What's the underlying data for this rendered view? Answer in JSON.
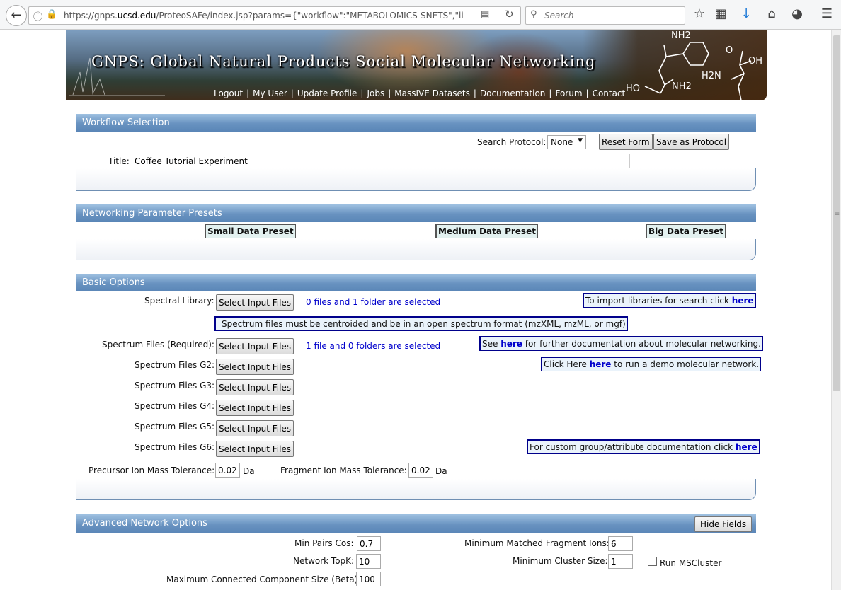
{
  "browser": {
    "url_prefix": "https://gnps.",
    "url_domain": "ucsd.edu",
    "url_rest": "/ProteoSAFe/index.jsp?params={\"workflow\":\"METABOLOMICS-SNETS\",\"library_on_se",
    "search_placeholder": "Search"
  },
  "banner": {
    "title": "GNPS: Global Natural Products Social Molecular Networking",
    "nav": [
      "Logout",
      "My User",
      "Update Profile",
      "Jobs",
      "MassIVE Datasets",
      "Documentation",
      "Forum",
      "Contact"
    ],
    "chem_labels": [
      "NH2",
      "O",
      "OH",
      "H2N",
      "HO",
      "NH2"
    ]
  },
  "workflow": {
    "heading": "Workflow Selection",
    "protocol_label": "Search Protocol:",
    "protocol_value": "None",
    "reset_label": "Reset Form",
    "save_label": "Save as Protocol",
    "title_label": "Title:",
    "title_value": "Coffee Tutorial Experiment"
  },
  "presets": {
    "heading": "Networking Parameter Presets",
    "small": "Small Data Preset",
    "medium": "Medium Data Preset",
    "big": "Big Data Preset"
  },
  "basic": {
    "heading": "Basic Options",
    "select_label": "Select Input Files",
    "library_label": "Spectral Library:",
    "library_status": "0 files and 1 folder are selected",
    "import_info": "To import libraries for search click ",
    "here": "here",
    "centroid_note": "Spectrum files must be centroided and be in an open spectrum format (mzXML, mzML, or mgf)",
    "spectrum_label": "Spectrum Files (Required):",
    "spectrum_status": "1 file and 0 folders are selected",
    "see_pre": "See ",
    "see_post": " for further documentation about molecular networking.",
    "g2": "Spectrum Files G2:",
    "g3": "Spectrum Files G3:",
    "g4": "Spectrum Files G4:",
    "g5": "Spectrum Files G5:",
    "g6": "Spectrum Files G6:",
    "demo_pre": "Click Here ",
    "demo_post": " to run a demo molecular network.",
    "custom_info": "For custom group/attribute documentation click ",
    "precursor_label": "Precursor Ion Mass Tolerance:",
    "precursor_value": "0.02",
    "fragment_label": "Fragment Ion Mass Tolerance:",
    "fragment_value": "0.02",
    "unit": "Da"
  },
  "advanced": {
    "heading": "Advanced Network Options",
    "hide_label": "Hide Fields",
    "min_pairs_label": "Min Pairs Cos:",
    "min_pairs_value": "0.7",
    "min_frag_label": "Minimum Matched Fragment Ions:",
    "min_frag_value": "6",
    "topk_label": "Network TopK:",
    "topk_value": "10",
    "cluster_label": "Minimum Cluster Size:",
    "cluster_value": "1",
    "mscluster_label": "Run MSCluster",
    "max_comp_label": "Maximum Connected Component Size (Beta):",
    "max_comp_value": "100"
  }
}
